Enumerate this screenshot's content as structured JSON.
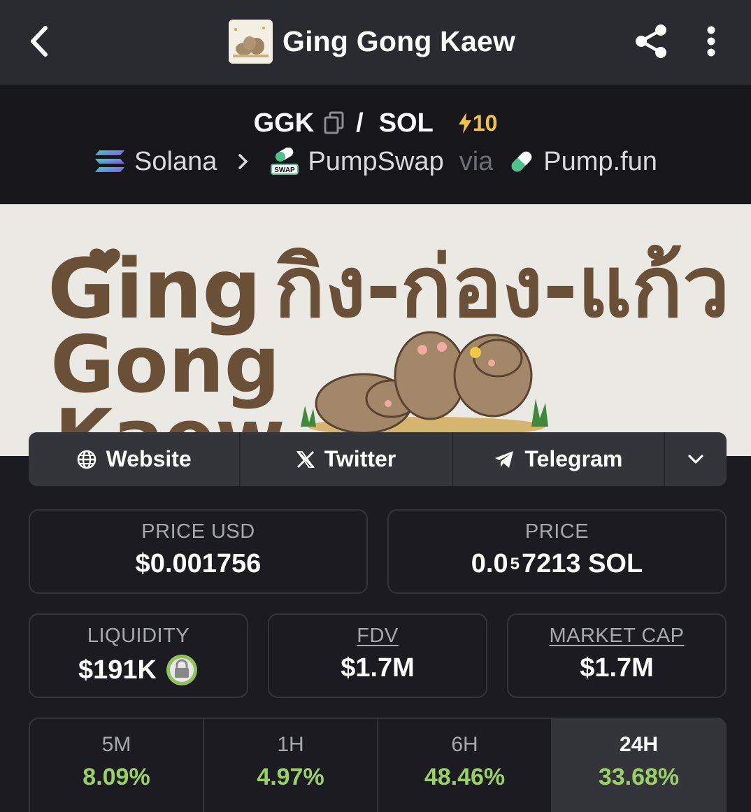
{
  "header": {
    "title": "Ging Gong Kaew",
    "back_icon": "chevron-left-icon",
    "share_icon": "share-icon",
    "more_icon": "more-vertical-icon"
  },
  "pair": {
    "base": "GGK",
    "separator": "/",
    "quote": "SOL",
    "boost": "10",
    "chain": "Solana",
    "dex": "PumpSwap",
    "dex_badge": "SWAP",
    "via": "via",
    "launchpad": "Pump.fun"
  },
  "banner": {
    "logo_text_lines": [
      "Ging",
      "Gong",
      "Kaew"
    ],
    "thai_text": "กิง-ก่อง-แก้ว"
  },
  "socials": [
    {
      "label": "Website",
      "icon": "globe-icon"
    },
    {
      "label": "Twitter",
      "icon": "x-logo-icon"
    },
    {
      "label": "Telegram",
      "icon": "telegram-icon"
    }
  ],
  "stats": {
    "price_usd": {
      "label": "PRICE USD",
      "value": "$0.001756"
    },
    "price_native": {
      "label": "PRICE",
      "prefix": "0.0",
      "zeros": "5",
      "suffix": "7213 SOL"
    },
    "liquidity": {
      "label": "LIQUIDITY",
      "value": "$191K"
    },
    "fdv": {
      "label": "FDV",
      "value": "$1.7M"
    },
    "market_cap": {
      "label": "MARKET CAP",
      "value": "$1.7M"
    }
  },
  "timeframes": [
    {
      "label": "5M",
      "change": "8.09%"
    },
    {
      "label": "1H",
      "change": "4.97%"
    },
    {
      "label": "6H",
      "change": "48.46%"
    },
    {
      "label": "24H",
      "change": "33.68%"
    }
  ],
  "colors": {
    "positive": "#9bd164",
    "boost": "#f5c33b",
    "background": "#1b1b21",
    "topbar": "#2a2a31"
  }
}
